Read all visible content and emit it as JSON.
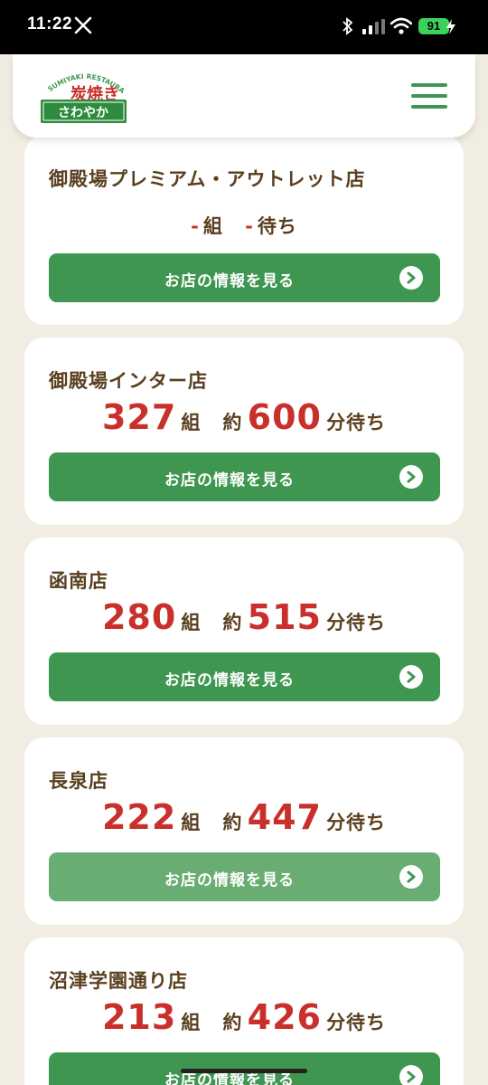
{
  "status_bar": {
    "time": "11:22",
    "battery": "91"
  },
  "header": {
    "logo_text_top": "SUMIYAKI RESTAURANT",
    "logo_text_main": "炭焼き",
    "logo_text_bottom": "さわやか"
  },
  "wait_labels": {
    "groups_unit": "組",
    "approx": "約",
    "minutes_wait": "分待ち",
    "wait_only": "待ち",
    "button_label": "お店の情報を見る"
  },
  "stores": [
    {
      "name": "御殿場プレミアム・アウトレット店",
      "groups": "-",
      "minutes": "-"
    },
    {
      "name": "御殿場インター店",
      "groups": "327",
      "minutes": "600"
    },
    {
      "name": "函南店",
      "groups": "280",
      "minutes": "515"
    },
    {
      "name": "長泉店",
      "groups": "222",
      "minutes": "447"
    },
    {
      "name": "沼津学園通り店",
      "groups": "213",
      "minutes": "426"
    }
  ],
  "colors": {
    "accent_green": "#3f9650",
    "number_red": "#c9302c",
    "text_brown": "#5a3f1f",
    "background": "#f2ede3"
  }
}
